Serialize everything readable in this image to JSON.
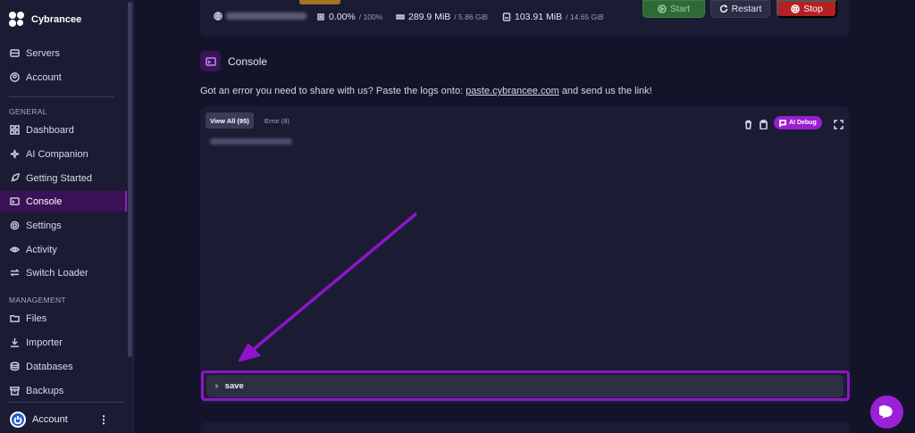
{
  "brand": {
    "name": "Cybrancee"
  },
  "sidebar": {
    "top_items": [
      {
        "label": "Servers",
        "icon": "server-icon"
      },
      {
        "label": "Account",
        "icon": "user-circle-icon"
      }
    ],
    "general_label": "GENERAL",
    "general_items": [
      {
        "label": "Dashboard",
        "icon": "dashboard-icon"
      },
      {
        "label": "AI Companion",
        "icon": "sparkle-icon"
      },
      {
        "label": "Getting Started",
        "icon": "rocket-icon"
      },
      {
        "label": "Console",
        "icon": "terminal-icon",
        "active": true
      },
      {
        "label": "Settings",
        "icon": "gear-icon"
      },
      {
        "label": "Activity",
        "icon": "eye-icon"
      },
      {
        "label": "Switch Loader",
        "icon": "swap-icon"
      }
    ],
    "management_label": "MANAGEMENT",
    "management_items": [
      {
        "label": "Files",
        "icon": "folder-icon"
      },
      {
        "label": "Importer",
        "icon": "download-icon"
      },
      {
        "label": "Databases",
        "icon": "database-icon"
      },
      {
        "label": "Backups",
        "icon": "archive-icon"
      }
    ],
    "footer": {
      "label": "Account"
    }
  },
  "stats": {
    "cpu": "0.00%",
    "cpu_limit": "/ 100%",
    "memory": "289.9 MiB",
    "memory_limit": "/ 5.86 GiB",
    "disk": "103.91 MiB",
    "disk_limit": "/ 14.65 GiB"
  },
  "power": {
    "start": "Start",
    "restart": "Restart",
    "stop": "Stop"
  },
  "console": {
    "title": "Console",
    "notice_prefix": "Got an error you need to share with us? Paste the logs onto: ",
    "notice_link": "paste.cybrancee.com",
    "notice_suffix": " and send us the link!",
    "tabs": [
      {
        "label": "View All (95)",
        "active": true
      },
      {
        "label": "Error (8)",
        "active": false
      }
    ],
    "ai_debug": "AI Debug",
    "command_value": "save"
  },
  "colors": {
    "accent": "#8f14c9",
    "start": "#2d6a35",
    "stop": "#b32123"
  }
}
